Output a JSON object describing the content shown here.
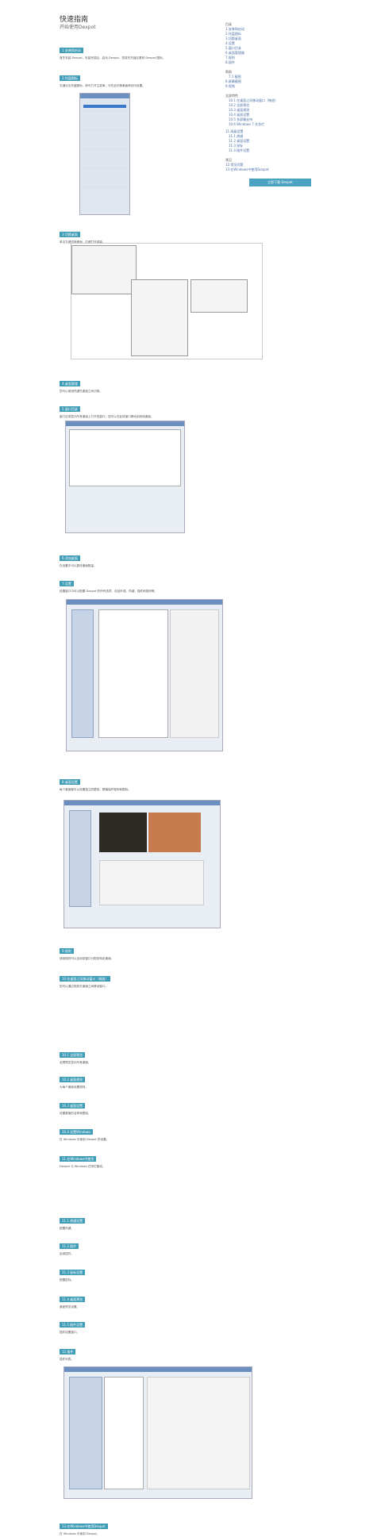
{
  "title": "快速指南",
  "subtitle": "开始使用Dexpot",
  "sidebar": {
    "h1": "目录",
    "items1": [
      "1.安装和启动",
      "2.托盘图标",
      "3.切换桌面",
      "4.设置",
      "5.窗口目录",
      "6.桌面管理器",
      "7.规则",
      "8.插件"
    ],
    "h2": "帮助",
    "items2": [
      "7.1 截图",
      "8.屏幕截图",
      "9.视频"
    ],
    "h3": "全部特性",
    "items3": [
      "10.1 在桌面之间移动窗口（拖放）",
      "10.2 全屏预览",
      "10.3 桌面规则",
      "10.4 桌面设置",
      "10.5 多屏幕支持",
      "10.6 Windows 7 任务栏"
    ],
    "items4": [
      "11.高级设置",
      "11.1 热键",
      "11.2 桌面设置",
      "11.3 鼠标",
      "11.4 插件设置"
    ],
    "h4": "常见",
    "items5": [
      "12.常见问题",
      "13.在Windows中使用Dexpot"
    ],
    "button": "立即下载 Dexpot"
  },
  "sections": [
    {
      "h": "1.安装和启动",
      "p": "首先安装 Dexpot。安装完成后，启动 Dexpot，您将在托盘区看到 Dexpot 图标。"
    },
    {
      "h": "2.托盘图标",
      "p": "右键点击托盘图标，即可打开主菜单，可在此切换桌面和访问设置。"
    },
    {
      "h": "3.切换桌面",
      "p": "单击左键切换桌面，右键打开菜单。"
    },
    {
      "h": "4.桌面管理",
      "p": "您可以使用热键在桌面之间切换。"
    },
    {
      "h": "5.窗口目录",
      "p": "窗口目录显示所有桌面上打开的窗口，您可以在此将窗口移动到其他桌面。"
    },
    {
      "h": "6.添加桌面",
      "p": "在设置中可以更改桌面数量。"
    },
    {
      "h": "7.设置",
      "p": "设置窗口中可以配置 Dexpot 的所有选项，包括外观、热键、插件和规则等。"
    },
    {
      "h": "8.桌面设置",
      "p": "每个桌面都可以设置独立的壁纸、屏幕保护程序和图标。"
    },
    {
      "h": "9.规则",
      "p": "使用规则可以自动将窗口分配到特定桌面。"
    },
    {
      "h": "10.在桌面之间移动窗口（拖放）",
      "p": "您可以通过拖放在桌面之间移动窗口。"
    },
    {
      "h": "10.1 全屏预览",
      "p": "全屏预览显示所有桌面。"
    },
    {
      "h": "10.2 桌面规则",
      "p": "为每个桌面设置规则。"
    },
    {
      "h": "10.3 桌面设置",
      "p": "设置桌面的名称和壁纸。"
    },
    {
      "h": "10.4 设置Windows",
      "p": "在 Windows 中使用 Dexpot 的设置。"
    },
    {
      "h": "11.在Windows中使用",
      "p": "Dexpot 与 Windows 任务栏集成。"
    },
    {
      "h": "11.1 热键设置",
      "p": "配置热键。"
    },
    {
      "h": "11.2 插件",
      "p": "启用插件。"
    },
    {
      "h": "11.3 鼠标设置",
      "p": "配置鼠标。"
    },
    {
      "h": "11.4 桌面预览",
      "p": "桌面预览设置。"
    },
    {
      "h": "11.5 插件设置",
      "p": "插件设置窗口。"
    },
    {
      "h": "12.插件",
      "p": "插件列表。"
    },
    {
      "h": "13.在Windows中使用Dexpot",
      "p": "在 Windows 中使用 Dexpot。"
    }
  ]
}
